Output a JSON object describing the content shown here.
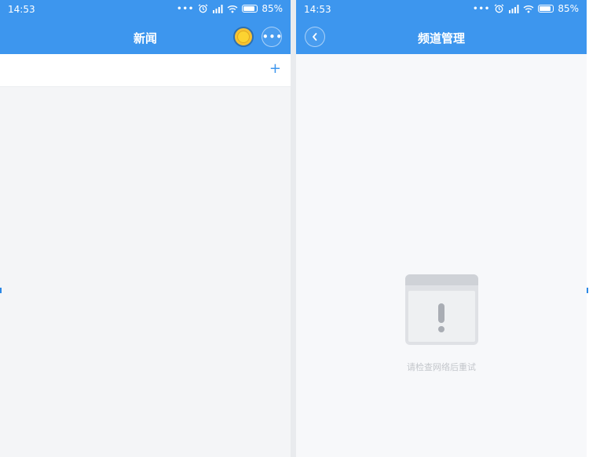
{
  "left_screen": {
    "status_bar": {
      "time": "14:53",
      "dots": "•••",
      "battery": "85%"
    },
    "nav": {
      "title": "新闻",
      "coin_icon": "coin-icon",
      "more_icon": "more-dots-icon",
      "more_glyph": "•••"
    },
    "channel_bar": {
      "add_label": "+"
    }
  },
  "right_screen": {
    "status_bar": {
      "time": "14:53",
      "dots": "•••",
      "battery": "85%"
    },
    "nav": {
      "title": "频道管理",
      "back_icon": "chevron-left-icon"
    },
    "error": {
      "illustration_icon": "window-exclamation-icon",
      "message": "请检查网络后重试"
    }
  },
  "colors": {
    "nav_blue": "#3d96ee",
    "left_bg": "#f4f5f7",
    "right_bg": "#f7f8fa",
    "error_text": "#c3c6cb",
    "coin_yellow": "#f6c234"
  }
}
